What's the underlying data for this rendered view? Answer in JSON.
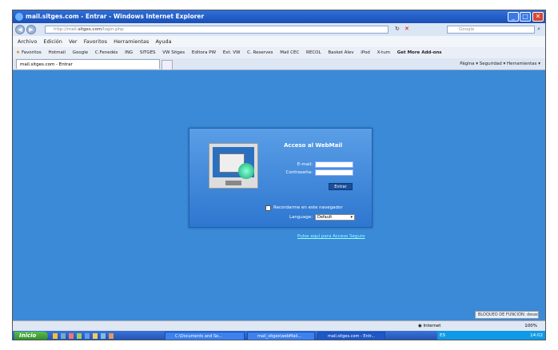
{
  "window": {
    "title": "mail.sitges.com - Entrar - Windows Internet Explorer"
  },
  "address": {
    "url_prefix": "http://mail.",
    "url_domain": "sitges.com",
    "url_path": "/login.php",
    "search_placeholder": "Google"
  },
  "menu": [
    "Archivo",
    "Edición",
    "Ver",
    "Favoritos",
    "Herramientas",
    "Ayuda"
  ],
  "favorites": {
    "label": "Favoritos",
    "items": [
      "Hotmail",
      "Google",
      "C.Fenedés",
      "ING",
      "SITGES",
      "VW Sitges",
      "Editora PW",
      "Ext. VW",
      "C. Reserves",
      "Mail CEC",
      "RECOL",
      "Basket Alev",
      "iPod",
      "X-tum",
      "Get More Add-ons"
    ]
  },
  "tab": {
    "label": "mail.sitges.com - Entrar"
  },
  "tools": "Página ▾  Seguridad ▾  Herramientas ▾",
  "login": {
    "title": "Acceso al WebMail",
    "email_label": "E-mail:",
    "password_label": "Contraseña:",
    "submit": "Entrar",
    "remember": "Recordarme en este navegador",
    "language_label": "Language:",
    "language_value": "Default",
    "secure_link": "Pulse aquí para Acceso Seguro"
  },
  "popup_notice": "BLOQUEO DE FUNCIÓN: desactivado",
  "status": {
    "zone": "Internet",
    "zoom": "100%"
  },
  "taskbar": {
    "start": "Inicio",
    "tasks": [
      "C:\\Documents and Se...",
      "mail_sitges\\webMail...",
      "mail.sitges.com - Entr..."
    ],
    "lang": "ES",
    "clock": "14:02"
  }
}
